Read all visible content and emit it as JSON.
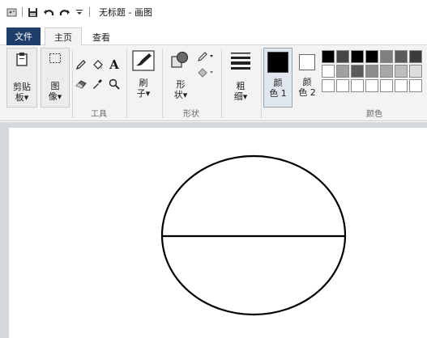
{
  "window": {
    "title": "无标题 - 画图"
  },
  "quick_access": {
    "icons": [
      "paint-app-icon",
      "save-icon",
      "undo-icon",
      "redo-icon",
      "customize-dropdown-icon"
    ]
  },
  "tabs": {
    "file": "文件",
    "home": "主页",
    "view": "查看"
  },
  "ribbon": {
    "clipboard": {
      "label_line1": "剪贴",
      "label_line2": "板▾"
    },
    "image": {
      "label_line1": "图",
      "label_line2": "像▾"
    },
    "tools": {
      "group_label": "工具",
      "icons": [
        "pencil-icon",
        "fill-icon",
        "text-icon",
        "eraser-icon",
        "color-picker-icon",
        "magnifier-icon"
      ]
    },
    "brushes": {
      "label_line1": "刷",
      "label_line2": "子▾"
    },
    "shapes": {
      "label_line1": "形",
      "label_line2": "状▾",
      "group_label": "形状"
    },
    "size": {
      "label_line1": "粗",
      "label_line2": "细▾"
    },
    "color1": {
      "label_line1": "颜",
      "label_line2": "色 1",
      "color": "#000000"
    },
    "color2": {
      "label_line1": "颜",
      "label_line2": "色 2",
      "color": "#ffffff"
    },
    "colors": {
      "group_label": "颜色",
      "palette_row1": [
        "#000000",
        "#464646",
        "#000000",
        "#000000",
        "#7f7f7f",
        "#5a5a5a",
        "#3c3c3c"
      ],
      "palette_row2": [
        "#ffffff",
        "#a0a0a0",
        "#5c5c5c",
        "#8c8c8c",
        "#a8a8a8",
        "#bdbdbd",
        "#dddddd"
      ],
      "palette_row3": [
        "#ffffff",
        "#ffffff",
        "#ffffff",
        "#ffffff",
        "#ffffff",
        "#ffffff",
        "#ffffff"
      ]
    }
  },
  "canvas": {
    "background": "#ffffff",
    "drawing": "ellipse-with-horizontal-diameter",
    "stroke_color": "#000000"
  }
}
